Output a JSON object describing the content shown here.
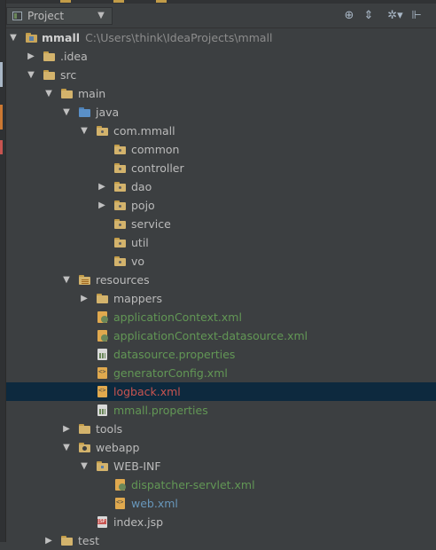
{
  "header": {
    "view_label": "Project",
    "dropdown_arrow": "▼",
    "tools": [
      {
        "name": "sync-icon",
        "glyph": "⊕"
      },
      {
        "name": "collapse-icon",
        "glyph": "⇕"
      },
      {
        "name": "settings-icon",
        "glyph": "✲▾"
      },
      {
        "name": "hide-icon",
        "glyph": "⊩"
      }
    ]
  },
  "tree": {
    "root": {
      "label": "mmall",
      "path": "C:\\Users\\think\\IdeaProjects\\mmall"
    },
    "items": [
      {
        "label": ".idea"
      },
      {
        "label": "src"
      },
      {
        "label": "main"
      },
      {
        "label": "java"
      },
      {
        "label": "com.mmall"
      },
      {
        "label": "common"
      },
      {
        "label": "controller"
      },
      {
        "label": "dao"
      },
      {
        "label": "pojo"
      },
      {
        "label": "service"
      },
      {
        "label": "util"
      },
      {
        "label": "vo"
      },
      {
        "label": "resources"
      },
      {
        "label": "mappers"
      },
      {
        "label": "applicationContext.xml"
      },
      {
        "label": "applicationContext-datasource.xml"
      },
      {
        "label": "datasource.properties"
      },
      {
        "label": "generatorConfig.xml"
      },
      {
        "label": "logback.xml"
      },
      {
        "label": "mmall.properties"
      },
      {
        "label": "tools"
      },
      {
        "label": "webapp"
      },
      {
        "label": "WEB-INF"
      },
      {
        "label": "dispatcher-servlet.xml"
      },
      {
        "label": "web.xml"
      },
      {
        "label": "index.jsp"
      },
      {
        "label": "test"
      }
    ]
  },
  "colors": {
    "background": "#3c3f41",
    "selected_row": "#0d293e",
    "added_file": "#629755",
    "modified_file": "#6897bb",
    "unversioned_file": "#c75450"
  }
}
